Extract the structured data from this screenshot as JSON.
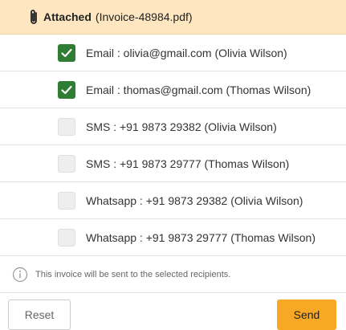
{
  "header": {
    "title": "Attached",
    "file": "(Invoice-48984.pdf)"
  },
  "recipients": [
    {
      "label": "Email : olivia@gmail.com (Olivia Wilson)",
      "checked": true
    },
    {
      "label": "Email : thomas@gmail.com (Thomas Wilson)",
      "checked": true
    },
    {
      "label": "SMS : +91 9873 29382 (Olivia Wilson)",
      "checked": false
    },
    {
      "label": "SMS : +91 9873 29777 (Thomas Wilson)",
      "checked": false
    },
    {
      "label": "Whatsapp : +91 9873 29382 (Olivia Wilson)",
      "checked": false
    },
    {
      "label": "Whatsapp : +91 9873 29777 (Thomas Wilson)",
      "checked": false
    }
  ],
  "info": {
    "text": "This invoice will be sent to the selected recipients."
  },
  "footer": {
    "reset_label": "Reset",
    "send_label": "Send"
  },
  "colors": {
    "header_bg": "#fde6c0",
    "checked": "#2e7d32",
    "send_button": "#f9a826"
  },
  "icons": {
    "attachment": "paperclip-icon",
    "info": "info-icon",
    "check": "checkmark-icon"
  }
}
